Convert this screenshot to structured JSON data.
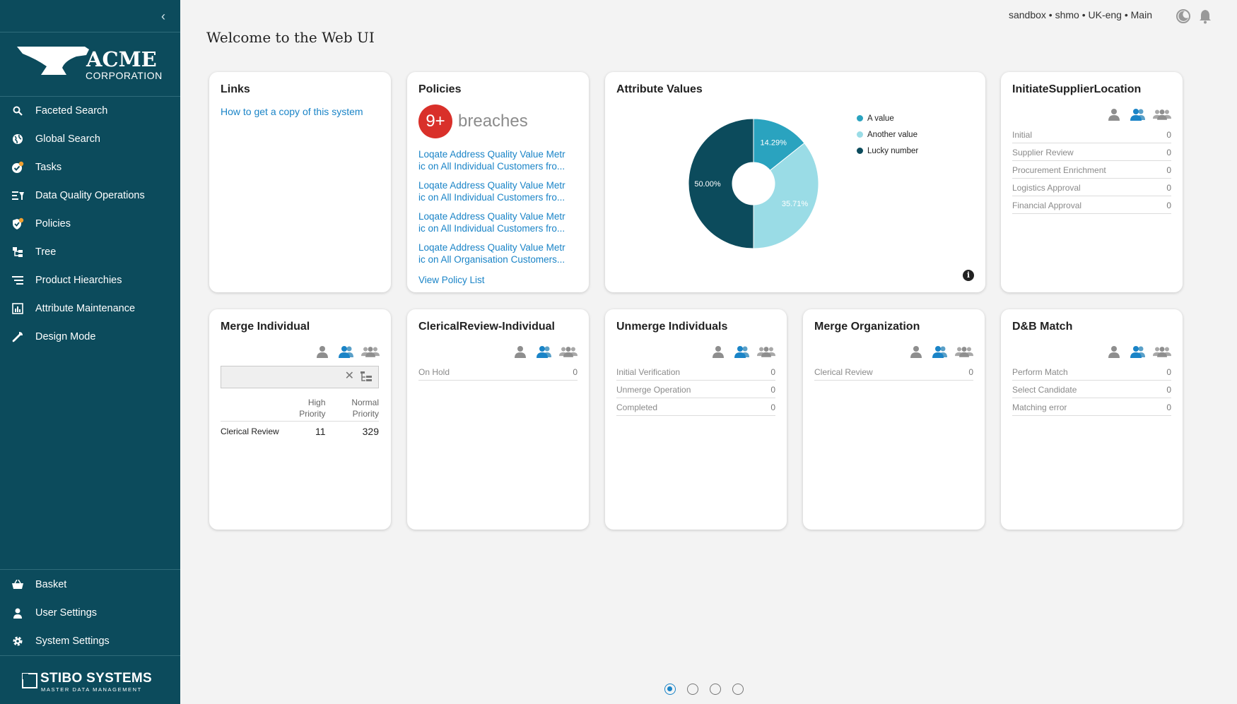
{
  "header": {
    "title": "Welcome to the Web UI",
    "context": "sandbox • shmo • UK-eng • Main"
  },
  "sidebar": {
    "brand_top": "ACME",
    "brand_bottom": "CORPORATION",
    "items": [
      {
        "label": "Faceted Search",
        "icon": "search-icon"
      },
      {
        "label": "Global Search",
        "icon": "globe-icon"
      },
      {
        "label": "Tasks",
        "icon": "tasks-icon"
      },
      {
        "label": "Data Quality Operations",
        "icon": "data-quality-icon"
      },
      {
        "label": "Policies",
        "icon": "policy-shield-icon"
      },
      {
        "label": "Tree",
        "icon": "tree-icon"
      },
      {
        "label": "Product Hiearchies",
        "icon": "hierarchy-icon"
      },
      {
        "label": "Attribute Maintenance",
        "icon": "attribute-icon"
      },
      {
        "label": "Design Mode",
        "icon": "wrench-icon"
      }
    ],
    "bottom_items": [
      {
        "label": "Basket",
        "icon": "basket-icon"
      },
      {
        "label": "User Settings",
        "icon": "user-icon"
      },
      {
        "label": "System Settings",
        "icon": "gear-icon"
      }
    ],
    "footer_brand": "STIBO SYSTEMS",
    "footer_sub": "MASTER DATA MANAGEMENT"
  },
  "cards": {
    "links": {
      "title": "Links",
      "items": [
        "How to get a copy of this system"
      ]
    },
    "policies": {
      "title": "Policies",
      "badge": "9+",
      "badge_label": "breaches",
      "items": [
        "Loqate Address Quality Value Metr\nic on All Individual Customers fro...",
        "Loqate Address Quality Value Metr\nic on All Individual Customers fro...",
        "Loqate Address Quality Value Metr\nic on All Individual Customers fro...",
        "Loqate Address Quality Value Metr\nic on All Organisation Customers..."
      ],
      "view_all": "View Policy List"
    },
    "attribute_values": {
      "title": "Attribute Values"
    },
    "initiate_supplier_location": {
      "title": "InitiateSupplierLocation",
      "states": [
        {
          "label": "Initial",
          "count": "0"
        },
        {
          "label": "Supplier Review",
          "count": "0"
        },
        {
          "label": "Procurement Enrichment",
          "count": "0"
        },
        {
          "label": "Logistics Approval",
          "count": "0"
        },
        {
          "label": "Financial Approval",
          "count": "0"
        }
      ]
    },
    "merge_individual": {
      "title": "Merge Individual",
      "col_high": "High Priority",
      "col_normal": "Normal Priority",
      "rows": [
        {
          "label": "Clerical Review",
          "high": "11",
          "normal": "329"
        }
      ]
    },
    "clerical_review_individual": {
      "title": "ClericalReview-Individual",
      "states": [
        {
          "label": "On Hold",
          "count": "0"
        }
      ]
    },
    "unmerge_individuals": {
      "title": "Unmerge Individuals",
      "states": [
        {
          "label": "Initial Verification",
          "count": "0"
        },
        {
          "label": "Unmerge Operation",
          "count": "0"
        },
        {
          "label": "Completed",
          "count": "0"
        }
      ]
    },
    "merge_organization": {
      "title": "Merge Organization",
      "states": [
        {
          "label": "Clerical Review",
          "count": "0"
        }
      ]
    },
    "dnb_match": {
      "title": "D&B Match",
      "states": [
        {
          "label": "Perform Match",
          "count": "0"
        },
        {
          "label": "Select Candidate",
          "count": "0"
        },
        {
          "label": "Matching error",
          "count": "0"
        }
      ]
    }
  },
  "chart_data": {
    "type": "pie",
    "title": "",
    "categories": [
      "A value",
      "Another value",
      "Lucky number"
    ],
    "values": [
      14.29,
      35.71,
      50.0
    ],
    "labels": [
      "14.29%",
      "35.71%",
      "50.00%"
    ],
    "colors": [
      "#2aa3bf",
      "#9adce6",
      "#0c4b5c"
    ],
    "legend_position": "top-right"
  },
  "pager": {
    "pages": 4,
    "active": 1
  }
}
